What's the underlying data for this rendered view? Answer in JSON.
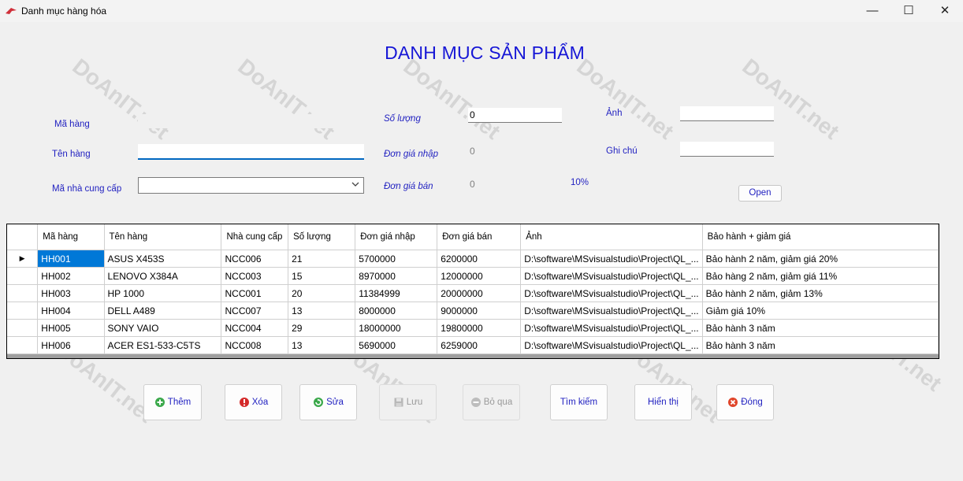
{
  "window": {
    "title": "Danh mục hàng hóa",
    "minimize": "—",
    "maximize": "☐",
    "close": "✕"
  },
  "form": {
    "heading": "DANH MỤC SẢN PHẨM",
    "labels": {
      "ma_hang": "Mã hàng",
      "ten_hang": "Tên hàng",
      "ma_ncc": "Mã nhà cung cấp",
      "so_luong": "Số lượng",
      "don_gia_nhap": "Đơn giá nhập",
      "don_gia_ban": "Đơn giá bán",
      "anh": "Ảnh",
      "ghi_chu": "Ghi chú",
      "percent": "10%"
    },
    "values": {
      "ma_hang": "",
      "ten_hang": "",
      "ma_ncc": "",
      "so_luong": "0",
      "don_gia_nhap": "0",
      "don_gia_ban": "0",
      "anh": "",
      "ghi_chu": ""
    },
    "open_button": "Open"
  },
  "grid": {
    "columns": [
      "Mã hàng",
      "Tên hàng",
      "Nhà cung cấp",
      "Số lượng",
      "Đơn giá nhập",
      "Đơn giá bán",
      "Ảnh",
      "Bảo hành + giảm giá"
    ],
    "rows": [
      [
        "HH001",
        "ASUS X453S",
        "NCC006",
        "21",
        "5700000",
        "6200000",
        "D:\\software\\MSvisualstudio\\Project\\QL_...",
        "Bảo hành 2 năm, giảm giá 20%"
      ],
      [
        "HH002",
        "LENOVO X384A",
        "NCC003",
        "15",
        "8970000",
        "12000000",
        "D:\\software\\MSvisualstudio\\Project\\QL_...",
        "Bảo hàng 2 năm, giảm giá 11%"
      ],
      [
        "HH003",
        "HP 1000",
        "NCC001",
        "20",
        "11384999",
        "20000000",
        "D:\\software\\MSvisualstudio\\Project\\QL_...",
        "Bảo hành 2 năm, giảm 13%"
      ],
      [
        "HH004",
        "DELL A489",
        "NCC007",
        "13",
        "8000000",
        "9000000",
        "D:\\software\\MSvisualstudio\\Project\\QL_...",
        "Giảm giá 10%"
      ],
      [
        "HH005",
        "SONY VAIO",
        "NCC004",
        "29",
        "18000000",
        "19800000",
        "D:\\software\\MSvisualstudio\\Project\\QL_...",
        "Bảo hành 3 năm"
      ],
      [
        "HH006",
        "ACER ES1-533-C5TS",
        "NCC008",
        "13",
        "5690000",
        "6259000",
        "D:\\software\\MSvisualstudio\\Project\\QL_...",
        "Bảo hành 3 năm"
      ]
    ],
    "selected_row_marker": "▶"
  },
  "buttons": {
    "them": "Thêm",
    "xoa": "Xóa",
    "sua": "Sửa",
    "luu": "Lưu",
    "bo_qua": "Bỏ qua",
    "tim_kiem": "Tìm kiếm",
    "hien_thi": "Hiển thị",
    "dong": "Đóng"
  },
  "watermark": "DoAnIT.net",
  "colors": {
    "label_blue": "#1f1fc0",
    "heading_blue": "#1616d6",
    "selection": "#0078d7"
  }
}
